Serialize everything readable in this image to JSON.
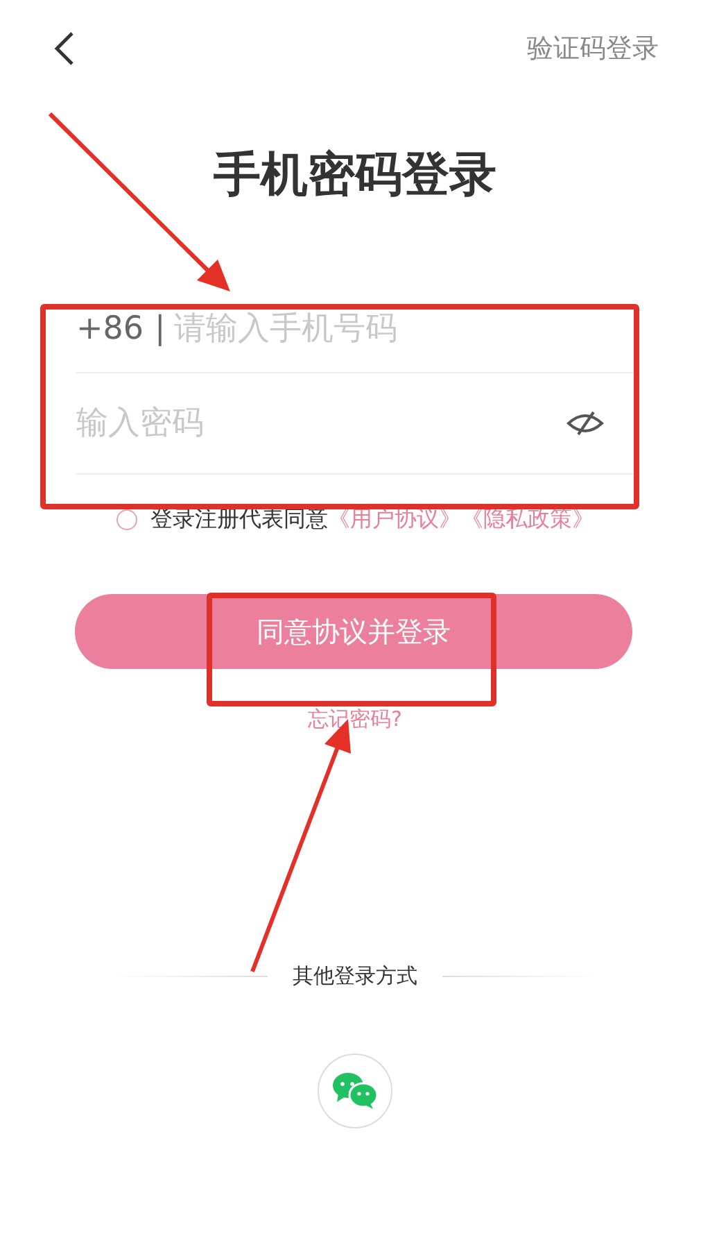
{
  "top_bar": {
    "switch_link": "验证码登录"
  },
  "title": "手机密码登录",
  "phone_field": {
    "prefix": "+86",
    "separator": "|",
    "placeholder": "请输入手机号码"
  },
  "password_field": {
    "placeholder": "输入密码",
    "visible": false
  },
  "agreement": {
    "checked": false,
    "text": "登录注册代表同意",
    "links": [
      "《用户协议》",
      "《隐私政策》"
    ]
  },
  "login_button": "同意协议并登录",
  "forgot_password": "忘记密码?",
  "other_login": {
    "label": "其他登录方式"
  }
}
